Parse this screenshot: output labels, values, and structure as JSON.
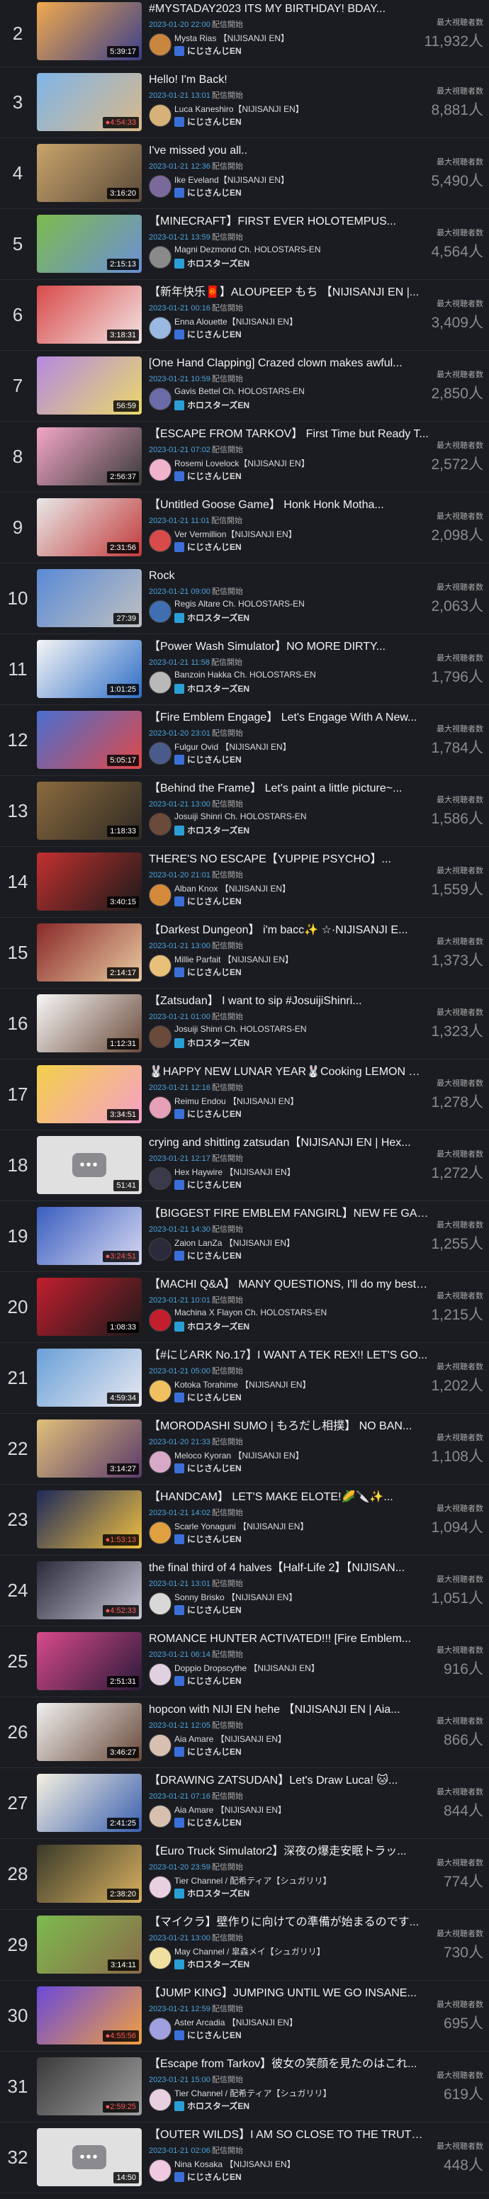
{
  "labels": {
    "views_label": "最大視聴者数",
    "stream_tag": "配信開始"
  },
  "entries": [
    {
      "rank": "2",
      "title": "#MYSTADAY2023 ITS MY BIRTHDAY! BDAY...",
      "date": "2023-01-20 22:00",
      "channel": "Mysta Rias 【NIJISANJI EN】",
      "org": "にじさんじEN",
      "duration": "5:39:17",
      "views": "11,932人",
      "colors": [
        "#f0a94e",
        "#3b3f8a"
      ],
      "avatar": "#c9863e"
    },
    {
      "rank": "3",
      "title": "Hello! I'm Back!",
      "date": "2023-01-21 13:01",
      "channel": "Luca Kaneshiro【NIJISANJI EN】",
      "org": "にじさんじEN",
      "duration": "●4:54:33",
      "live": true,
      "views": "8,881人",
      "colors": [
        "#7fb6e8",
        "#d9b88a"
      ],
      "avatar": "#d6b27a"
    },
    {
      "rank": "4",
      "title": "I've missed you all..",
      "date": "2023-01-21 12:36",
      "channel": "Ike Eveland【NIJISANJI EN】",
      "org": "にじさんじEN",
      "duration": "3:16:20",
      "views": "5,490人",
      "colors": [
        "#c9a46b",
        "#5a4a3a"
      ],
      "avatar": "#7a6a9c"
    },
    {
      "rank": "5",
      "title": "【MINECRAFT】FIRST EVER HOLOTEMPUS...",
      "date": "2023-01-21 13:59",
      "channel": "Magni Dezmond Ch. HOLOSTARS-EN",
      "org": "ホロスターズEN",
      "duration": "2:15:13",
      "views": "4,564人",
      "colors": [
        "#7dbb4e",
        "#6b8fd6"
      ],
      "avatar": "#8a8a8a"
    },
    {
      "rank": "6",
      "title": "【新年快乐🧧】ALOUPEEP もち 【NIJISANJI EN |...",
      "date": "2023-01-21 00:16",
      "channel": "Enna Alouette【NIJISANJI EN】",
      "org": "にじさんじEN",
      "duration": "3:18:31",
      "views": "3,409人",
      "colors": [
        "#d94b4b",
        "#f3e3e3"
      ],
      "avatar": "#9ab8e0"
    },
    {
      "rank": "7",
      "title": "[One Hand Clapping] Crazed clown makes awful...",
      "date": "2023-01-21 10:59",
      "channel": "Gavis Bettel Ch. HOLOSTARS-EN",
      "org": "ホロスターズEN",
      "duration": "56:59",
      "views": "2,850人",
      "colors": [
        "#b58ae0",
        "#e9d86a"
      ],
      "avatar": "#6b6ba8"
    },
    {
      "rank": "8",
      "title": "【ESCAPE FROM TARKOV】 First Time but Ready T...",
      "date": "2023-01-21 07:02",
      "channel": "Rosemi Lovelock【NIJISANJI EN】",
      "org": "にじさんじEN",
      "duration": "2:56:37",
      "views": "2,572人",
      "colors": [
        "#f2a6c6",
        "#3a3a3a"
      ],
      "avatar": "#f0b3cc"
    },
    {
      "rank": "9",
      "title": "【Untitled Goose Game】 Honk Honk Motha...",
      "date": "2023-01-21 11:01",
      "channel": "Ver Vermillion【NIJISANJI EN】",
      "org": "にじさんじEN",
      "duration": "2:31:56",
      "views": "2,098人",
      "colors": [
        "#e8e8e8",
        "#c23b3b"
      ],
      "avatar": "#d94a4a"
    },
    {
      "rank": "10",
      "title": "Rock",
      "date": "2023-01-21 09:00",
      "channel": "Regis Altare Ch. HOLOSTARS-EN",
      "org": "ホロスターズEN",
      "duration": "27:39",
      "views": "2,063人",
      "colors": [
        "#5a8ad6",
        "#c0c0c0"
      ],
      "avatar": "#3f6fb0"
    },
    {
      "rank": "11",
      "title": "【Power Wash Simulator】NO MORE DIRTY...",
      "date": "2023-01-21 11:58",
      "channel": "Banzoin Hakka Ch. HOLOSTARS-EN",
      "org": "ホロスターズEN",
      "duration": "1:01:25",
      "views": "1,796人",
      "colors": [
        "#f5f5f5",
        "#2f6ec7"
      ],
      "avatar": "#b9b9b9"
    },
    {
      "rank": "12",
      "title": "【Fire Emblem Engage】 Let's Engage With A New...",
      "date": "2023-01-20 23:01",
      "channel": "Fulgur Ovid 【NIJISANJI EN】",
      "org": "にじさんじEN",
      "duration": "5:05:17",
      "views": "1,784人",
      "colors": [
        "#4a6fd0",
        "#e04848"
      ],
      "avatar": "#4a5a8a"
    },
    {
      "rank": "13",
      "title": "【Behind the Frame】 Let's paint a little picture~...",
      "date": "2023-01-21 13:00",
      "channel": "Josuiji Shinri Ch. HOLOSTARS-EN",
      "org": "ホロスターズEN",
      "duration": "1:18:33",
      "views": "1,586人",
      "colors": [
        "#8b6a3e",
        "#2e2a24"
      ],
      "avatar": "#6a4a3a"
    },
    {
      "rank": "14",
      "title": "THERE'S NO ESCAPE【YUPPIE PSYCHO】...",
      "date": "2023-01-20 21:01",
      "channel": "Alban Knox 【NIJISANJI EN】",
      "org": "にじさんじEN",
      "duration": "3:40:15",
      "views": "1,559人",
      "colors": [
        "#c23030",
        "#1a1a1a"
      ],
      "avatar": "#d48a3a"
    },
    {
      "rank": "15",
      "title": "【Darkest Dungeon】 i'm bacc✨ ☆·NIJISANJI E...",
      "date": "2023-01-21 13:00",
      "channel": "Millie Parfait 【NIJISANJI EN】",
      "org": "にじさんじEN",
      "duration": "2:14:17",
      "views": "1,373人",
      "colors": [
        "#8a2a2a",
        "#e8c9a0"
      ],
      "avatar": "#e8c07a"
    },
    {
      "rank": "16",
      "title": "【Zatsudan】 I want to sip #JosuijiShinri...",
      "date": "2023-01-21 01:00",
      "channel": "Josuiji Shinri Ch. HOLOSTARS-EN",
      "org": "ホロスターズEN",
      "duration": "1:12:31",
      "views": "1,323人",
      "colors": [
        "#f7f7f7",
        "#6b4a3a"
      ],
      "avatar": "#6a4a3a"
    },
    {
      "rank": "17",
      "title": "🐰HAPPY NEW LUNAR YEAR🐰Cooking LEMON 🍋...",
      "date": "2023-01-21 12:16",
      "channel": "Reimu Endou 【NIJISANJI EN】",
      "org": "にじさんじEN",
      "duration": "3:34:51",
      "views": "1,278人",
      "colors": [
        "#f3d04a",
        "#f5a0c8"
      ],
      "avatar": "#e6a0b8"
    },
    {
      "rank": "18",
      "title": "crying and shitting zatsudan【NIJISANJI EN | Hex...",
      "date": "2023-01-21 12:17",
      "channel": "Hex Haywire 【NIJISANJI EN】",
      "org": "にじさんじEN",
      "duration": "51:41",
      "views": "1,272人",
      "placeholder": true,
      "colors": [
        "#e0e0e0",
        "#e0e0e0"
      ],
      "avatar": "#3a3a4a"
    },
    {
      "rank": "19",
      "title": "【BIGGEST FIRE EMBLEM FANGIRL】NEW FE GAM...",
      "date": "2023-01-21 14:30",
      "channel": "Zaion LanZa 【NIJISANJI EN】",
      "org": "にじさんじEN",
      "duration": "●3:24:51",
      "live": true,
      "views": "1,255人",
      "colors": [
        "#3a5fc0",
        "#d8d8f0"
      ],
      "avatar": "#2a2a3a"
    },
    {
      "rank": "20",
      "title": "【MACHI Q&A】 MANY QUESTIONS, I'll do my best!!...",
      "date": "2023-01-21 10:01",
      "channel": "Machina X Flayon Ch. HOLOSTARS-EN",
      "org": "ホロスターズEN",
      "duration": "1:08:33",
      "views": "1,215人",
      "colors": [
        "#c21e2e",
        "#1a1a1a"
      ],
      "avatar": "#c21e2e"
    },
    {
      "rank": "21",
      "title": "【#にじARK No.17】I WANT A TEK REX!! LET'S GO...",
      "date": "2023-01-21 05:00",
      "channel": "Kotoka Torahime 【NIJISANJI EN】",
      "org": "にじさんじEN",
      "duration": "4:59:34",
      "views": "1,202人",
      "colors": [
        "#6aa0d8",
        "#e8e8f0"
      ],
      "avatar": "#f0c060"
    },
    {
      "rank": "22",
      "title": "【MORODASHI SUMO | もろだし相撲】 NO BAN...",
      "date": "2023-01-20 21:33",
      "channel": "Meloco Kyoran 【NIJISANJI EN】",
      "org": "にじさんじEN",
      "duration": "3:14:27",
      "views": "1,108人",
      "colors": [
        "#e0c07a",
        "#5a3a6a"
      ],
      "avatar": "#d8a8c8"
    },
    {
      "rank": "23",
      "title": "【HANDCAM】 LET'S MAKE ELOTE!🌽🔪✨...",
      "date": "2023-01-21 14:02",
      "channel": "Scarle Yonaguni 【NIJISANJI EN】",
      "org": "にじさんじEN",
      "duration": "●1:53:13",
      "live": true,
      "views": "1,094人",
      "colors": [
        "#1e2a5a",
        "#f0c040"
      ],
      "avatar": "#e0a040"
    },
    {
      "rank": "24",
      "title": "the final third of 4 halves【Half-Life 2】【NIJISAN...",
      "date": "2023-01-21 13:01",
      "channel": "Sonny Brisko 【NIJISANJI EN】",
      "org": "にじさんじEN",
      "duration": "●4:52:33",
      "live": true,
      "views": "1,051人",
      "colors": [
        "#2a2a3a",
        "#c8c8d8"
      ],
      "avatar": "#d8d8d8"
    },
    {
      "rank": "25",
      "title": "ROMANCE HUNTER ACTIVATED!!! [Fire Emblem...",
      "date": "2023-01-21 06:14",
      "channel": "Doppio Dropscythe 【NIJISANJI EN】",
      "org": "にじさんじEN",
      "duration": "2:51:31",
      "views": "916人",
      "colors": [
        "#d84a8a",
        "#2a1a3a"
      ],
      "avatar": "#e0d0e0"
    },
    {
      "rank": "26",
      "title": "hopcon with NIJI EN hehe 【NIJISANJI EN | Aia...",
      "date": "2023-01-21 12:05",
      "channel": "Aia Amare 【NIJISANJI EN】",
      "org": "にじさんじEN",
      "duration": "3:46:27",
      "views": "866人",
      "colors": [
        "#f0f0f0",
        "#6a4a3a"
      ],
      "avatar": "#d8c0b0"
    },
    {
      "rank": "27",
      "title": "【DRAWING ZATSUDAN】Let's Draw Luca! 🐱...",
      "date": "2023-01-21 07:16",
      "channel": "Aia Amare 【NIJISANJI EN】",
      "org": "にじさんじEN",
      "duration": "2:41:25",
      "views": "844人",
      "colors": [
        "#f5f0e0",
        "#3a5fb0"
      ],
      "avatar": "#d8c0b0"
    },
    {
      "rank": "28",
      "title": "【Euro Truck Simulator2】深夜の爆走安眠トラッ...",
      "date": "2023-01-20 23:59",
      "channel": "Tier Channel / 配希ティア【シュガリリ】",
      "org": "ホロスターズEN",
      "duration": "2:38:20",
      "views": "774人",
      "colors": [
        "#3a3a2a",
        "#d8b060"
      ],
      "avatar": "#e8d0e0"
    },
    {
      "rank": "29",
      "title": "【マイクラ】壁作りに向けての準備が始まるのです...",
      "date": "2023-01-21 13:00",
      "channel": "May Channel / 皐森メイ【シュガリリ】",
      "org": "ホロスターズEN",
      "duration": "3:14:11",
      "views": "730人",
      "colors": [
        "#7dbb4e",
        "#8a6a4a"
      ],
      "avatar": "#f0e0a0"
    },
    {
      "rank": "30",
      "title": "【JUMP KING】JUMPING UNTIL WE GO INSANE...",
      "date": "2023-01-21 12:59",
      "channel": "Aster Arcadia 【NIJISANJI EN】",
      "org": "にじさんじEN",
      "duration": "●4:55:56",
      "live": true,
      "views": "695人",
      "colors": [
        "#6a4ad8",
        "#f0a040"
      ],
      "avatar": "#a0a0e0"
    },
    {
      "rank": "31",
      "title": "【Escape from Tarkov】彼女の笑顔を見たのはこれ...",
      "date": "2023-01-21 15:00",
      "channel": "Tier Channel / 配希ティア【シュガリリ】",
      "org": "ホロスターズEN",
      "duration": "●2:59:25",
      "live": true,
      "views": "619人",
      "colors": [
        "#3a3a3a",
        "#a0a0a0"
      ],
      "avatar": "#e8d0e0"
    },
    {
      "rank": "32",
      "title": "【OUTER WILDS】I AM SO CLOSE TO THE TRUTH...",
      "date": "2023-01-21 02:06",
      "channel": "Nina Kosaka 【NIJISANJI EN】",
      "org": "にじさんじEN",
      "duration": "14:50",
      "views": "448人",
      "placeholder": true,
      "colors": [
        "#e0e0e0",
        "#e0e0e0"
      ],
      "avatar": "#f0c8e0"
    }
  ]
}
